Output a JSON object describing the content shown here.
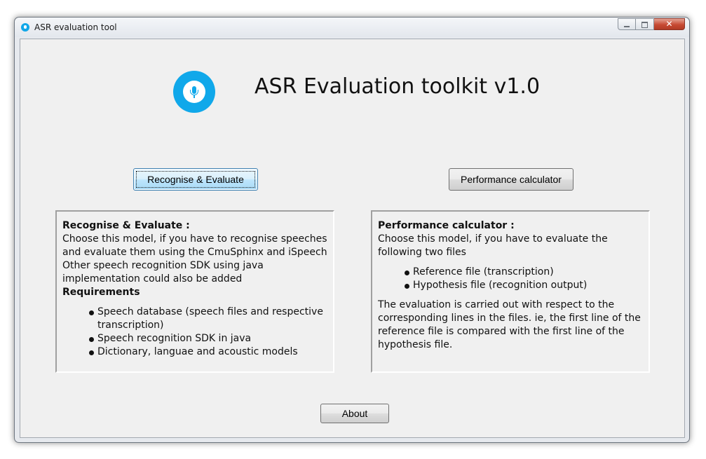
{
  "window": {
    "title": "ASR evaluation tool",
    "close_glyph": "✕",
    "accent_color": "#10a8ea"
  },
  "header": {
    "logo_icon": "microphone-icon",
    "title": "ASR Evaluation toolkit v1.0"
  },
  "buttons": {
    "recognise": "Recognise & Evaluate",
    "performance": "Performance calculator",
    "about": "About"
  },
  "left_panel": {
    "heading": "Recognise & Evaluate :",
    "description_lines": [
      "Choose this model, if you have to recognise speeches",
      "and evaluate them using the CmuSphinx and iSpeech",
      "Other speech recognition SDK using java",
      "implementation could also be added"
    ],
    "requirements_heading": "Requirements",
    "requirements": [
      [
        "Speech database (speech files and respective",
        "transcription)"
      ],
      [
        "Speech recognition SDK in java"
      ],
      [
        "Dictionary, languae and acoustic models"
      ]
    ]
  },
  "right_panel": {
    "heading": "Performance calculator :",
    "description_lines": [
      "Choose this model, if you have to evaluate the",
      "following two files"
    ],
    "files": [
      "Reference file (transcription)",
      "Hypothesis file (recognition output)"
    ],
    "note_lines": [
      "The evaluation is carried out with respect to the",
      "corresponding lines in the files. ie, the first line of the",
      "reference file is compared with the first line of the",
      "hypothesis file."
    ]
  }
}
